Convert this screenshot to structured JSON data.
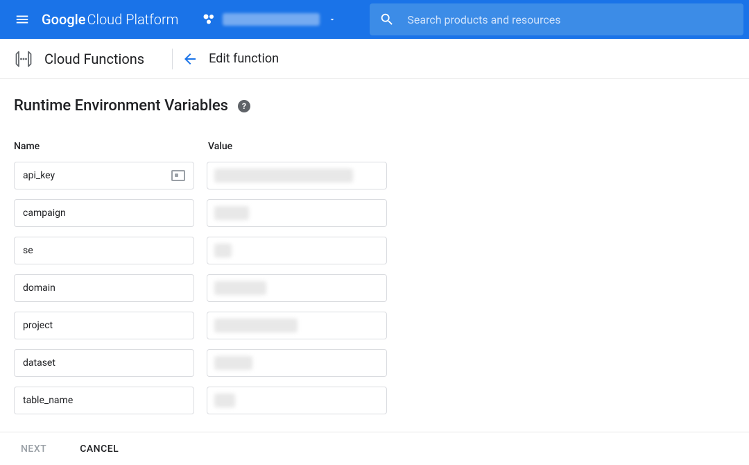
{
  "header": {
    "product_name_strong": "Google",
    "product_name_rest": " Cloud Platform",
    "search_placeholder": "Search products and resources"
  },
  "subheader": {
    "service_name": "Cloud Functions",
    "page_title": "Edit function"
  },
  "section": {
    "title": "Runtime Environment Variables",
    "help_symbol": "?"
  },
  "columns": {
    "name_header": "Name",
    "value_header": "Value"
  },
  "env_vars": [
    {
      "name": "api_key",
      "value_redacted_width": 200,
      "show_card_icon": true
    },
    {
      "name": "campaign",
      "value_redacted_width": 50
    },
    {
      "name": "se",
      "value_redacted_width": 25
    },
    {
      "name": "domain",
      "value_redacted_width": 75
    },
    {
      "name": "project",
      "value_redacted_width": 120
    },
    {
      "name": "dataset",
      "value_redacted_width": 55
    },
    {
      "name": "table_name",
      "value_redacted_width": 30
    }
  ],
  "footer": {
    "next_label": "NEXT",
    "cancel_label": "CANCEL"
  }
}
